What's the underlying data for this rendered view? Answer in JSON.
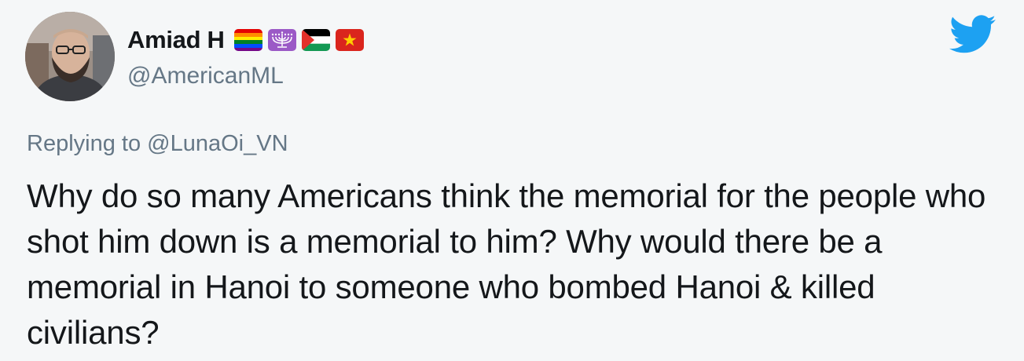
{
  "tweet": {
    "display_name": "Amiad H",
    "handle": "@AmericanML",
    "flags": [
      "rainbow-flag-icon",
      "menorah-icon",
      "palestine-flag-icon",
      "vietnam-flag-icon"
    ],
    "replying_prefix": "Replying to",
    "replying_to": "@LunaOi_VN",
    "text": "Why do so many Americans think the memorial for the people who shot him down is a memorial to him? Why would there be a memorial in Hanoi to someone who bombed Hanoi & killed civilians?"
  },
  "colors": {
    "background": "#f5f7f8",
    "twitter_blue": "#1da1f2",
    "muted_text": "#657786",
    "primary_text": "#14171a"
  }
}
